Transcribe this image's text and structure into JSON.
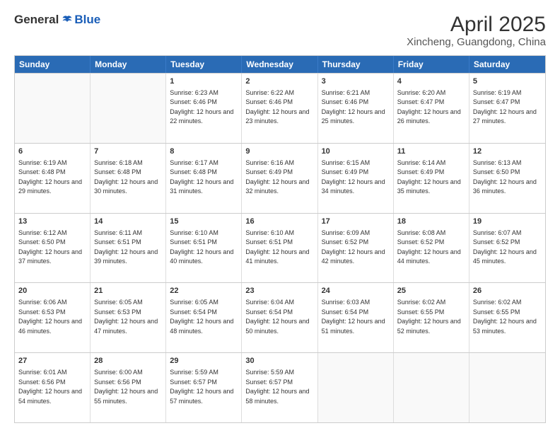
{
  "logo": {
    "general": "General",
    "blue": "Blue"
  },
  "header": {
    "title": "April 2025",
    "subtitle": "Xincheng, Guangdong, China"
  },
  "days": [
    "Sunday",
    "Monday",
    "Tuesday",
    "Wednesday",
    "Thursday",
    "Friday",
    "Saturday"
  ],
  "weeks": [
    [
      {
        "num": "",
        "sunrise": "",
        "sunset": "",
        "daylight": ""
      },
      {
        "num": "",
        "sunrise": "",
        "sunset": "",
        "daylight": ""
      },
      {
        "num": "1",
        "sunrise": "Sunrise: 6:23 AM",
        "sunset": "Sunset: 6:46 PM",
        "daylight": "Daylight: 12 hours and 22 minutes."
      },
      {
        "num": "2",
        "sunrise": "Sunrise: 6:22 AM",
        "sunset": "Sunset: 6:46 PM",
        "daylight": "Daylight: 12 hours and 23 minutes."
      },
      {
        "num": "3",
        "sunrise": "Sunrise: 6:21 AM",
        "sunset": "Sunset: 6:46 PM",
        "daylight": "Daylight: 12 hours and 25 minutes."
      },
      {
        "num": "4",
        "sunrise": "Sunrise: 6:20 AM",
        "sunset": "Sunset: 6:47 PM",
        "daylight": "Daylight: 12 hours and 26 minutes."
      },
      {
        "num": "5",
        "sunrise": "Sunrise: 6:19 AM",
        "sunset": "Sunset: 6:47 PM",
        "daylight": "Daylight: 12 hours and 27 minutes."
      }
    ],
    [
      {
        "num": "6",
        "sunrise": "Sunrise: 6:19 AM",
        "sunset": "Sunset: 6:48 PM",
        "daylight": "Daylight: 12 hours and 29 minutes."
      },
      {
        "num": "7",
        "sunrise": "Sunrise: 6:18 AM",
        "sunset": "Sunset: 6:48 PM",
        "daylight": "Daylight: 12 hours and 30 minutes."
      },
      {
        "num": "8",
        "sunrise": "Sunrise: 6:17 AM",
        "sunset": "Sunset: 6:48 PM",
        "daylight": "Daylight: 12 hours and 31 minutes."
      },
      {
        "num": "9",
        "sunrise": "Sunrise: 6:16 AM",
        "sunset": "Sunset: 6:49 PM",
        "daylight": "Daylight: 12 hours and 32 minutes."
      },
      {
        "num": "10",
        "sunrise": "Sunrise: 6:15 AM",
        "sunset": "Sunset: 6:49 PM",
        "daylight": "Daylight: 12 hours and 34 minutes."
      },
      {
        "num": "11",
        "sunrise": "Sunrise: 6:14 AM",
        "sunset": "Sunset: 6:49 PM",
        "daylight": "Daylight: 12 hours and 35 minutes."
      },
      {
        "num": "12",
        "sunrise": "Sunrise: 6:13 AM",
        "sunset": "Sunset: 6:50 PM",
        "daylight": "Daylight: 12 hours and 36 minutes."
      }
    ],
    [
      {
        "num": "13",
        "sunrise": "Sunrise: 6:12 AM",
        "sunset": "Sunset: 6:50 PM",
        "daylight": "Daylight: 12 hours and 37 minutes."
      },
      {
        "num": "14",
        "sunrise": "Sunrise: 6:11 AM",
        "sunset": "Sunset: 6:51 PM",
        "daylight": "Daylight: 12 hours and 39 minutes."
      },
      {
        "num": "15",
        "sunrise": "Sunrise: 6:10 AM",
        "sunset": "Sunset: 6:51 PM",
        "daylight": "Daylight: 12 hours and 40 minutes."
      },
      {
        "num": "16",
        "sunrise": "Sunrise: 6:10 AM",
        "sunset": "Sunset: 6:51 PM",
        "daylight": "Daylight: 12 hours and 41 minutes."
      },
      {
        "num": "17",
        "sunrise": "Sunrise: 6:09 AM",
        "sunset": "Sunset: 6:52 PM",
        "daylight": "Daylight: 12 hours and 42 minutes."
      },
      {
        "num": "18",
        "sunrise": "Sunrise: 6:08 AM",
        "sunset": "Sunset: 6:52 PM",
        "daylight": "Daylight: 12 hours and 44 minutes."
      },
      {
        "num": "19",
        "sunrise": "Sunrise: 6:07 AM",
        "sunset": "Sunset: 6:52 PM",
        "daylight": "Daylight: 12 hours and 45 minutes."
      }
    ],
    [
      {
        "num": "20",
        "sunrise": "Sunrise: 6:06 AM",
        "sunset": "Sunset: 6:53 PM",
        "daylight": "Daylight: 12 hours and 46 minutes."
      },
      {
        "num": "21",
        "sunrise": "Sunrise: 6:05 AM",
        "sunset": "Sunset: 6:53 PM",
        "daylight": "Daylight: 12 hours and 47 minutes."
      },
      {
        "num": "22",
        "sunrise": "Sunrise: 6:05 AM",
        "sunset": "Sunset: 6:54 PM",
        "daylight": "Daylight: 12 hours and 48 minutes."
      },
      {
        "num": "23",
        "sunrise": "Sunrise: 6:04 AM",
        "sunset": "Sunset: 6:54 PM",
        "daylight": "Daylight: 12 hours and 50 minutes."
      },
      {
        "num": "24",
        "sunrise": "Sunrise: 6:03 AM",
        "sunset": "Sunset: 6:54 PM",
        "daylight": "Daylight: 12 hours and 51 minutes."
      },
      {
        "num": "25",
        "sunrise": "Sunrise: 6:02 AM",
        "sunset": "Sunset: 6:55 PM",
        "daylight": "Daylight: 12 hours and 52 minutes."
      },
      {
        "num": "26",
        "sunrise": "Sunrise: 6:02 AM",
        "sunset": "Sunset: 6:55 PM",
        "daylight": "Daylight: 12 hours and 53 minutes."
      }
    ],
    [
      {
        "num": "27",
        "sunrise": "Sunrise: 6:01 AM",
        "sunset": "Sunset: 6:56 PM",
        "daylight": "Daylight: 12 hours and 54 minutes."
      },
      {
        "num": "28",
        "sunrise": "Sunrise: 6:00 AM",
        "sunset": "Sunset: 6:56 PM",
        "daylight": "Daylight: 12 hours and 55 minutes."
      },
      {
        "num": "29",
        "sunrise": "Sunrise: 5:59 AM",
        "sunset": "Sunset: 6:57 PM",
        "daylight": "Daylight: 12 hours and 57 minutes."
      },
      {
        "num": "30",
        "sunrise": "Sunrise: 5:59 AM",
        "sunset": "Sunset: 6:57 PM",
        "daylight": "Daylight: 12 hours and 58 minutes."
      },
      {
        "num": "",
        "sunrise": "",
        "sunset": "",
        "daylight": ""
      },
      {
        "num": "",
        "sunrise": "",
        "sunset": "",
        "daylight": ""
      },
      {
        "num": "",
        "sunrise": "",
        "sunset": "",
        "daylight": ""
      }
    ]
  ]
}
